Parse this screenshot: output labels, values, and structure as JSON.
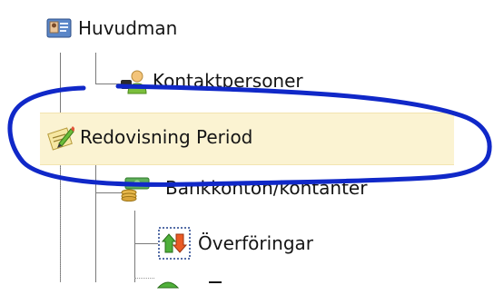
{
  "tree": {
    "items": [
      {
        "label": "Huvudman",
        "icon": "id-card-icon"
      },
      {
        "label": "Kontaktpersoner",
        "icon": "contacts-icon"
      },
      {
        "label": "Redovisning Period",
        "icon": "edit-document-icon",
        "selected": true
      },
      {
        "label": "Bankkonton/kontanter",
        "icon": "money-icon"
      },
      {
        "label": "Överföringar",
        "icon": "transfer-icon"
      }
    ]
  },
  "annotation": {
    "shape": "hand-drawn ellipse",
    "color": "#1028c8"
  },
  "colors": {
    "selection": "#fbf3d2",
    "text": "#151515"
  }
}
